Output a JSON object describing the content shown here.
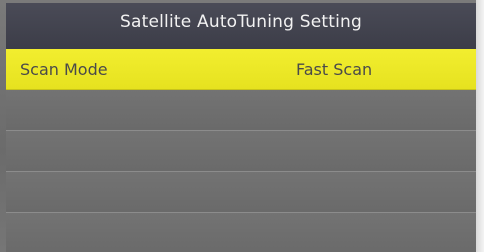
{
  "window": {
    "title": "Satellite AutoTuning Setting"
  },
  "menu": {
    "items": [
      {
        "label": "Scan Mode",
        "value": "Fast Scan",
        "selected": true
      },
      {
        "label": "",
        "value": "",
        "selected": false
      },
      {
        "label": "",
        "value": "",
        "selected": false
      },
      {
        "label": "",
        "value": "",
        "selected": false
      },
      {
        "label": "",
        "value": "",
        "selected": false
      }
    ]
  },
  "colors": {
    "title_bar": "#43444f",
    "highlight": "#efeb2a",
    "row_background": "#6f6f6f",
    "row_divider": "#8c8c8c"
  }
}
